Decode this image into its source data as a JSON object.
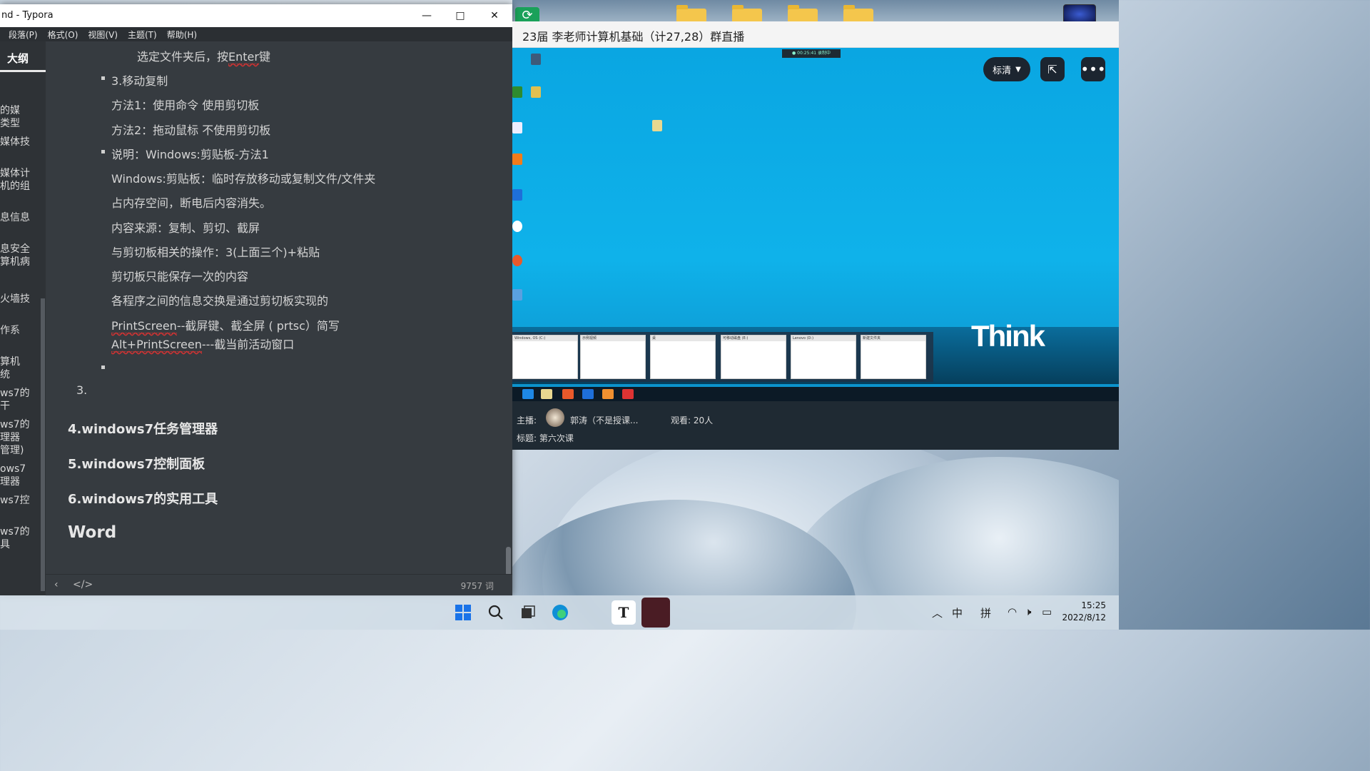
{
  "typora": {
    "title": "nd - Typora",
    "menu": [
      "段落(P)",
      "格式(O)",
      "视图(V)",
      "主题(T)",
      "帮助(H)"
    ],
    "outline_tab": "大纲",
    "outline_items": [
      "的媒\n类型",
      "媒体技",
      "媒体计\n机的组",
      "息信息",
      "息安全\n算机病",
      "火墙技",
      "作系",
      "算机\n统",
      "ws7的\n干",
      "ws7的\n理器\n管理)",
      "ows7\n理器",
      "ws7控",
      "ws7的\n具"
    ],
    "content": {
      "l1": "选定文件夹后，按",
      "l1b": "Enter",
      "l1c": "键",
      "b1": "3.移动复制",
      "m1": "方法1：使用命令  使用剪切板",
      "m2": "方法2：拖动鼠标 不使用剪切板",
      "b2": "说明：Windows:剪贴板-方法1",
      "p1": "Windows:剪贴板：临时存放移动或复制文件/文件夹",
      "p2": "占内存空间，断电后内容消失。",
      "p3": "内容来源：复制、剪切、截屏",
      "p4": "与剪切板相关的操作：3(上面三个)+粘贴",
      "p5": "剪切板只能保存一次的内容",
      "p6": "各程序之间的信息交换是通过剪切板实现的",
      "p7a": "PrintScreen",
      "p7b": "--截屏键、截全屏 ( prtsc）简写",
      "p8a": "Alt+PrintScreen",
      "p8b": "---截当前活动窗口",
      "num3": "3.",
      "h4_1": "4.windows7任务管理器",
      "h4_2": "5.windows7控制面板",
      "h4_3": "6.windows7的实用工具",
      "h2": "Word"
    },
    "word_count": "9757 词"
  },
  "live": {
    "title": "23届 李老师计算机基础（计27,28）群直播",
    "quality": "标清",
    "host_label": "主播:",
    "host_name": "郭涛（不是授课...",
    "viewers": "观看: 20人",
    "topic": "标题: 第六次课",
    "think_logo": "Think",
    "thumbs": [
      "Windows, OS (C:)",
      "示例视频",
      "桌",
      "可移动磁盘 (E:)",
      "Lenovo (D:)",
      "新建文件夹"
    ]
  },
  "taskbar": {
    "ime_cn": "中",
    "ime_pin": "拼",
    "time": "15:25",
    "date": "2022/8/12",
    "typora_letter": "T"
  }
}
